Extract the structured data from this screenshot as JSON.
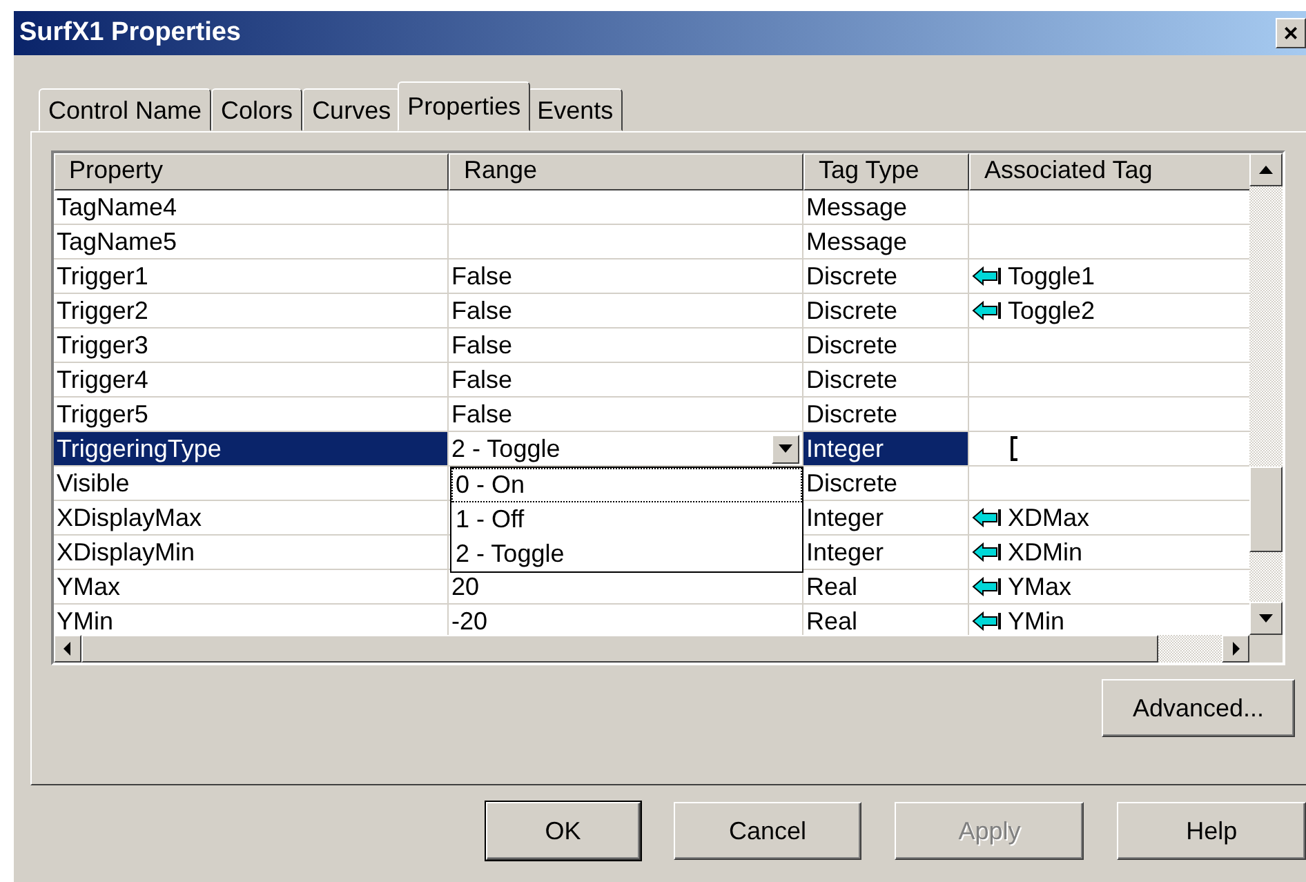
{
  "window": {
    "title": "SurfX1 Properties",
    "close_label": "×"
  },
  "tabs": [
    {
      "label": "Control Name",
      "selected": false
    },
    {
      "label": "Colors",
      "selected": false
    },
    {
      "label": "Curves",
      "selected": false
    },
    {
      "label": "Properties",
      "selected": true
    },
    {
      "label": "Events",
      "selected": false
    }
  ],
  "table": {
    "columns": [
      "Property",
      "Range",
      "Tag Type",
      "Associated Tag"
    ],
    "rows": [
      {
        "property": "TagName4",
        "range": "",
        "tag_type": "Message",
        "associated_tag": "",
        "selected": false
      },
      {
        "property": "TagName5",
        "range": "",
        "tag_type": "Message",
        "associated_tag": "",
        "selected": false
      },
      {
        "property": "Trigger1",
        "range": "False",
        "tag_type": "Discrete",
        "associated_tag": "Toggle1",
        "selected": false
      },
      {
        "property": "Trigger2",
        "range": "False",
        "tag_type": "Discrete",
        "associated_tag": "Toggle2",
        "selected": false
      },
      {
        "property": "Trigger3",
        "range": "False",
        "tag_type": "Discrete",
        "associated_tag": "",
        "selected": false
      },
      {
        "property": "Trigger4",
        "range": "False",
        "tag_type": "Discrete",
        "associated_tag": "",
        "selected": false
      },
      {
        "property": "Trigger5",
        "range": "False",
        "tag_type": "Discrete",
        "associated_tag": "",
        "selected": false
      },
      {
        "property": "TriggeringType",
        "range": "2 - Toggle",
        "tag_type": "Integer",
        "associated_tag": "",
        "selected": true
      },
      {
        "property": "Visible",
        "range": "",
        "tag_type": "Discrete",
        "associated_tag": "",
        "selected": false
      },
      {
        "property": "XDisplayMax",
        "range": "",
        "tag_type": "Integer",
        "associated_tag": "XDMax",
        "selected": false
      },
      {
        "property": "XDisplayMin",
        "range": "",
        "tag_type": "Integer",
        "associated_tag": "XDMin",
        "selected": false
      },
      {
        "property": "YMax",
        "range": "20",
        "tag_type": "Real",
        "associated_tag": "YMax",
        "selected": false
      },
      {
        "property": "YMin",
        "range": "-20",
        "tag_type": "Real",
        "associated_tag": "YMin",
        "selected": false
      }
    ]
  },
  "dropdown": {
    "options": [
      {
        "label": "0 - On",
        "focused": true
      },
      {
        "label": "1 - Off",
        "focused": false
      },
      {
        "label": "2 - Toggle",
        "focused": false
      }
    ]
  },
  "advanced_button": {
    "label": "Advanced..."
  },
  "buttons": [
    {
      "label": "OK",
      "disabled": false,
      "default": true
    },
    {
      "label": "Cancel",
      "disabled": false,
      "default": false
    },
    {
      "label": "Apply",
      "disabled": true,
      "default": false
    },
    {
      "label": "Help",
      "disabled": false,
      "default": false
    }
  ]
}
